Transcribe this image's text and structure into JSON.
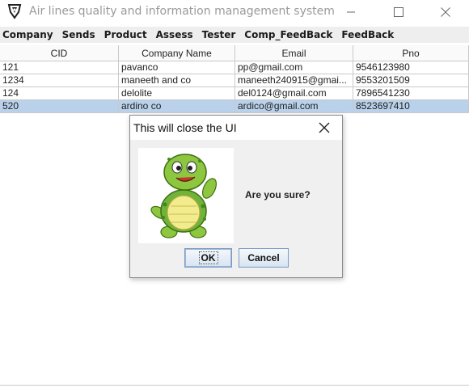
{
  "window": {
    "title": "Air lines quality and information management system",
    "logo_icon": "shield-logo-icon",
    "controls": [
      "minimize-icon",
      "maximize-icon",
      "close-icon"
    ]
  },
  "menu": [
    "Company",
    "Sends",
    "Product",
    "Assess",
    "Tester",
    "Comp_FeedBack",
    "FeedBack"
  ],
  "table": {
    "columns": [
      "CID",
      "Company Name",
      "Email",
      "Pno"
    ],
    "rows": [
      [
        "121",
        "pavanco",
        "pp@gmail.com",
        "9546123980"
      ],
      [
        "1234",
        "maneeth and co",
        "maneeth240915@gmai...",
        "9553201509"
      ],
      [
        "124",
        "delolite",
        "del0124@gmail.com",
        "7896541230"
      ],
      [
        "520",
        "ardino co",
        "ardico@gmail.com",
        "8523697410"
      ]
    ],
    "selected_row": 3,
    "selection_color": "#b9d1ea"
  },
  "dialog": {
    "title": "This will close the UI",
    "message": "Are you sure?",
    "image_icon": "turtle-icon",
    "ok_label": "OK",
    "cancel_label": "Cancel"
  }
}
